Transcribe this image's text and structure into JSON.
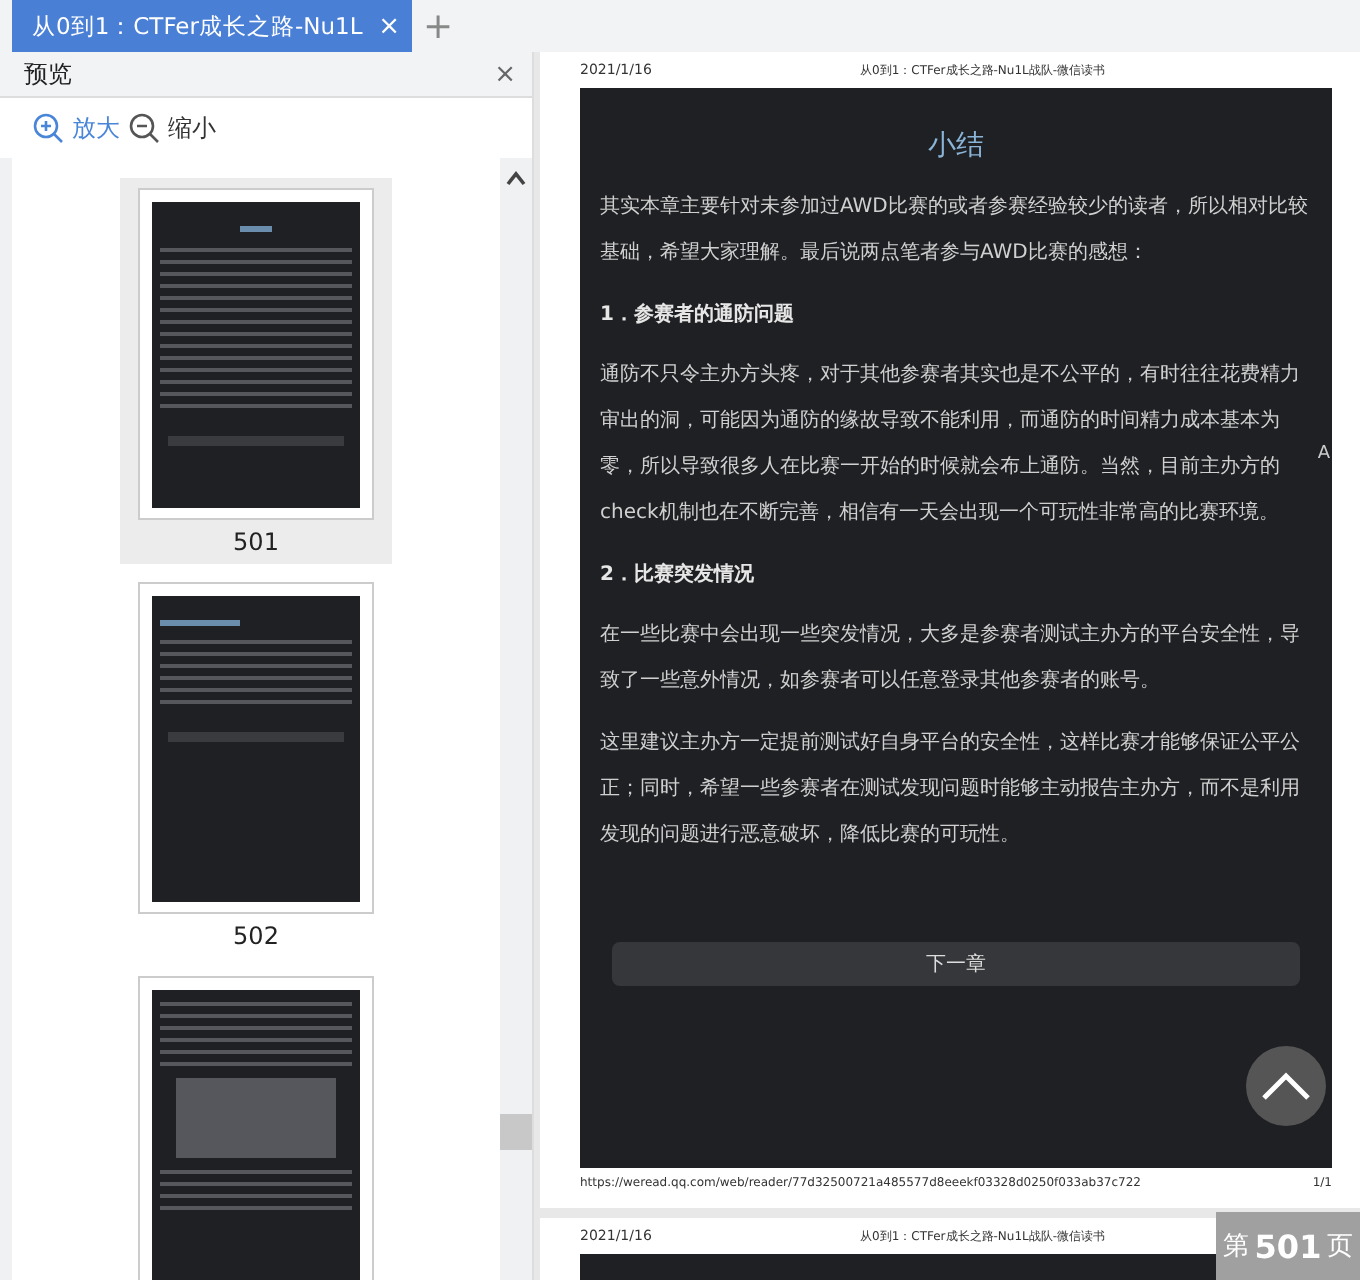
{
  "tabs": [
    {
      "label": "从0到1：CTFer成长之路-Nu1L",
      "selected": true,
      "close": "×"
    }
  ],
  "new_tab": "+",
  "sidebar": {
    "title": "预览",
    "close": "×",
    "zoom_in": "放大",
    "zoom_out": "缩小",
    "thumbnails": [
      {
        "kind": "summary",
        "label": "501",
        "selected": true
      },
      {
        "kind": "chapter",
        "label": "502",
        "selected": false
      },
      {
        "kind": "figure",
        "selected": false
      }
    ]
  },
  "pages": [
    {
      "date": "2021/1/16",
      "title": "从0到1：CTFer成长之路-Nu1L战队-微信读书",
      "blocks": [
        {
          "kind": "title",
          "text": "小结"
        },
        {
          "kind": "para",
          "text": "其实本章主要针对未参加过AWD比赛的或者参赛经验较少的读者，所以相对比较基础，希望大家理解。最后说两点笔者参与AWD比赛的感想："
        },
        {
          "kind": "heading",
          "text": "1．参赛者的通防问题"
        },
        {
          "kind": "para",
          "text": "通防不只令主办方头疼，对于其他参赛者其实也是不公平的，有时往往花费精力审出的洞，可能因为通防的缘故导致不能利用，而通防的时间精力成本基本为零，所以导致很多人在比赛一开始的时候就会布上通防。当然，目前主办方的check机制也在不断完善，相信有一天会出现一个可玩性非常高的比赛环境。",
          "margin_mark": "A"
        },
        {
          "kind": "heading",
          "text": "2．比赛突发情况"
        },
        {
          "kind": "para",
          "text": "在一些比赛中会出现一些突发情况，大多是参赛者测试主办方的平台安全性，导致了一些意外情况，如参赛者可以任意登录其他参赛者的账号。"
        },
        {
          "kind": "para",
          "text": "这里建议主办方一定提前测试好自身平台的安全性，这样比赛才能够保证公平公正；同时，希望一些参赛者在测试发现问题时能够主动报告主办方，而不是利用发现的问题进行恶意破坏，降低比赛的可玩性。"
        },
        {
          "kind": "button",
          "text": "下一章"
        }
      ],
      "url": "https://weread.qq.com/web/reader/77d32500721a485577d8eeekf03328d0250f033ab37c722",
      "page_count": "1/1"
    },
    {
      "date": "2021/1/16",
      "title": "从0到1：CTFer成长之路-Nu1L战队-微信读书"
    }
  ],
  "page_indicator": {
    "prefix": "第",
    "number": "501",
    "suffix": "页"
  }
}
